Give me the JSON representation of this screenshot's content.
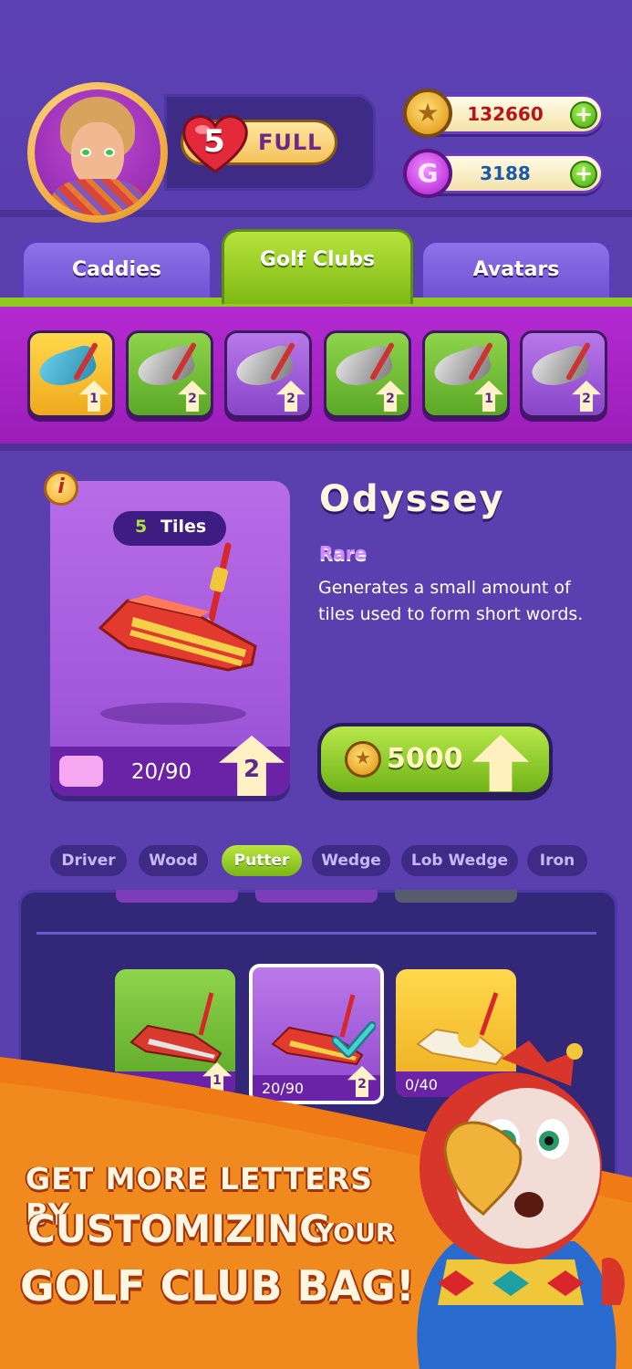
{
  "header": {
    "lives_count": "5",
    "lives_status": "FULL",
    "coins": "132660",
    "gems": "3188"
  },
  "tabs": [
    {
      "label": "Caddies",
      "active": false
    },
    {
      "label": "Golf Clubs",
      "active": true
    },
    {
      "label": "Avatars",
      "active": false
    }
  ],
  "club_strip": [
    {
      "level": "1",
      "color": "yellow",
      "icon": "target-club-icon"
    },
    {
      "level": "2",
      "color": "green",
      "icon": "iron-club-icon"
    },
    {
      "level": "2",
      "color": "purple",
      "icon": "putter-club-icon"
    },
    {
      "level": "2",
      "color": "green",
      "icon": "iron-club-icon"
    },
    {
      "level": "1",
      "color": "green",
      "icon": "iron-club-icon"
    },
    {
      "level": "2",
      "color": "purple",
      "icon": "gold-iron-club-icon"
    }
  ],
  "detail": {
    "info_glyph": "i",
    "tiles_count": "5",
    "tiles_label": "Tiles",
    "progress": "20/90",
    "progress_fraction": 0.22,
    "level": "2",
    "name": "Odyssey",
    "rarity": "Rare",
    "description": "Generates a small amount of tiles used to form short words.",
    "price": "5000"
  },
  "filters": [
    {
      "label": "Driver",
      "active": false
    },
    {
      "label": "Wood",
      "active": false
    },
    {
      "label": "Putter",
      "active": true
    },
    {
      "label": "Wedge",
      "active": false
    },
    {
      "label": "Lob Wedge",
      "active": false
    },
    {
      "label": "Iron",
      "active": false
    }
  ],
  "bag": {
    "cards": [
      {
        "progress": "",
        "level": "1",
        "color": "green"
      },
      {
        "progress": "20/90",
        "level": "2",
        "color": "purple",
        "equipped": true
      },
      {
        "progress": "0/40",
        "level": "",
        "color": "yellow"
      }
    ]
  },
  "promo": {
    "line1": "GET MORE LETTERS BY",
    "line2a": "CUSTOMIZING",
    "line2b": "YOUR",
    "line3": "GOLF CLUB BAG!"
  },
  "colors": {
    "background": "#5a3fae",
    "accent_green": "#8fcb1f",
    "accent_purple": "#b32ad0",
    "promo_orange": "#f07a16"
  }
}
